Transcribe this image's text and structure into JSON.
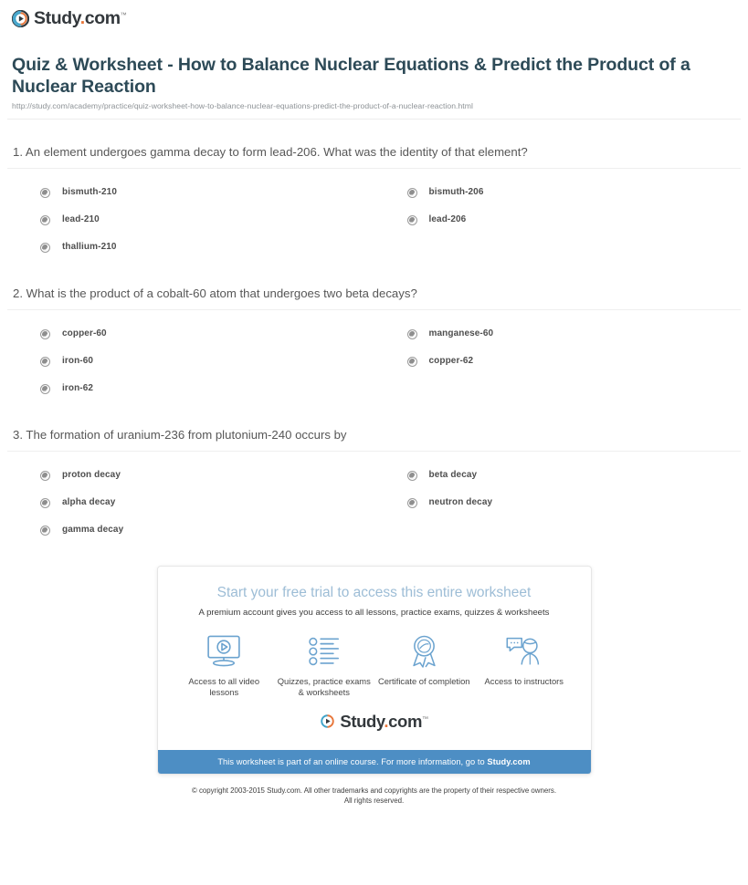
{
  "brand": {
    "name_main": "Study",
    "name_dot": ".",
    "name_tld": "com",
    "trademark": "™",
    "play_icon": "play-circle-icon"
  },
  "header": {
    "title": "Quiz & Worksheet - How to Balance Nuclear Equations & Predict the Product of a Nuclear Reaction",
    "url": "http://study.com/academy/practice/quiz-worksheet-how-to-balance-nuclear-equations-predict-the-product-of-a-nuclear-reaction.html"
  },
  "questions": [
    {
      "text": "1. An element undergoes gamma decay to form lead-206. What was the identity of that element?",
      "options": [
        "bismuth-210",
        "bismuth-206",
        "lead-210",
        "lead-206",
        "thallium-210"
      ]
    },
    {
      "text": "2. What is the product of a cobalt-60 atom that undergoes two beta decays?",
      "options": [
        "copper-60",
        "manganese-60",
        "iron-60",
        "copper-62",
        "iron-62"
      ]
    },
    {
      "text": "3. The formation of uranium-236 from plutonium-240 occurs by",
      "options": [
        "proton decay",
        "beta decay",
        "alpha decay",
        "neutron decay",
        "gamma decay"
      ]
    }
  ],
  "promo": {
    "heading": "Start your free trial to access this entire worksheet",
    "subheading": "A premium account gives you access to all lessons, practice exams, quizzes & worksheets",
    "features": [
      {
        "icon": "monitor-video-icon",
        "label": "Access to all video lessons"
      },
      {
        "icon": "checklist-icon",
        "label": "Quizzes, practice exams & worksheets"
      },
      {
        "icon": "award-ribbon-icon",
        "label": "Certificate of completion"
      },
      {
        "icon": "instructor-chat-icon",
        "label": "Access to instructors"
      }
    ],
    "banner_text": "This worksheet is part of an online course. For more information, go to ",
    "banner_link": "Study.com",
    "banner_color": "#4d8ec4"
  },
  "footer": {
    "line1": "© copyright 2003-2015 Study.com. All other trademarks and copyrights are the property of their respective owners.",
    "line2": "All rights reserved."
  },
  "colors": {
    "title": "#2d4a57",
    "promo_heading": "#9dbdd6",
    "accent_orange": "#e8763a",
    "icon_blue": "#6ba3cf"
  }
}
